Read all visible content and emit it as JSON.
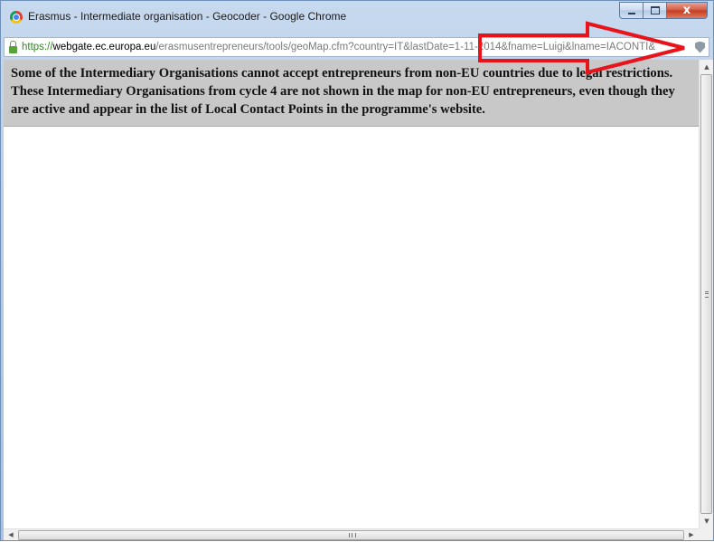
{
  "window": {
    "title": "Erasmus - Intermediate organisation - Geocoder - Google Chrome",
    "icon": "chrome-icon",
    "controls": {
      "minimize": "minimize-icon",
      "maximize": "maximize-icon",
      "close_label": "x"
    }
  },
  "address_bar": {
    "scheme": "https://",
    "host": "webgate.ec.europa.eu",
    "path": "/erasmusentrepreneurs/tools/geoMap.cfm?country=IT&lastDate=1-11-2014&fname=Luigi&lname=IACONTI&",
    "lock_icon": "lock-icon",
    "right_icon": "shield-icon"
  },
  "notice": {
    "text": "Some of the Intermediary Organisations cannot accept entrepreneurs from non-EU countries due to legal restrictions. These Intermediary Organisations from cycle 4 are not shown in the map for non-EU entrepreneurs, even though they are active and appear in the list of Local Contact Points in the programme's website.",
    "background": "#c8c8c8"
  },
  "annotation": {
    "color": "#e8141c",
    "shape": "arrow-pointing-right-at-url"
  },
  "scrollbars": {
    "vertical": "visible",
    "horizontal": "visible"
  }
}
